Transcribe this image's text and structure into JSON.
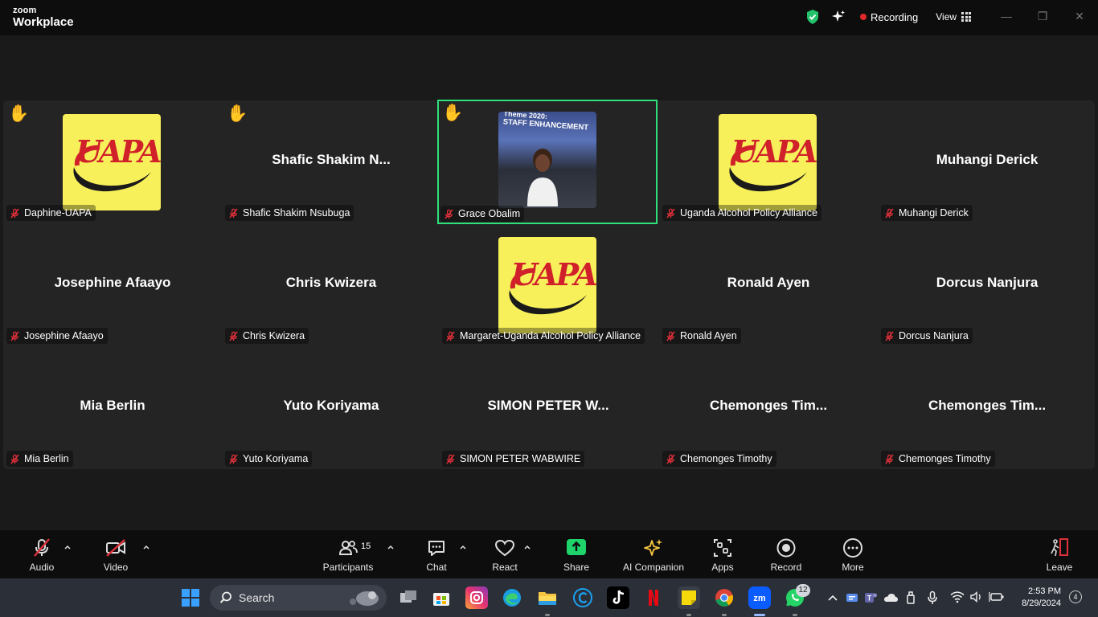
{
  "titlebar": {
    "brand_top": "zoom",
    "brand_bottom": "Workplace",
    "recording_label": "Recording",
    "view_label": "View",
    "minimize_icon": "minimize-icon",
    "maximize_icon": "maximize-icon",
    "close_icon": "close-icon"
  },
  "tiles": [
    {
      "name": "Daphine-UAPA",
      "center": "",
      "avatar": "uapa",
      "hand": true,
      "active": false
    },
    {
      "name": "Shafic Shakim Nsubuga",
      "center": "Shafic  Shakim  N...",
      "avatar": "",
      "hand": true,
      "active": false
    },
    {
      "name": "Grace Obalim",
      "center": "",
      "avatar": "photo",
      "hand": true,
      "active": true
    },
    {
      "name": "Uganda Alcohol Policy Alliance",
      "center": "",
      "avatar": "uapa",
      "hand": false,
      "active": false
    },
    {
      "name": "Muhangi Derick",
      "center": "Muhangi Derick",
      "avatar": "",
      "hand": false,
      "active": false
    },
    {
      "name": "Josephine Afaayo",
      "center": "Josephine Afaayo",
      "avatar": "",
      "hand": false,
      "active": false
    },
    {
      "name": "Chris Kwizera",
      "center": "Chris Kwizera",
      "avatar": "",
      "hand": false,
      "active": false
    },
    {
      "name": "Margaret-Uganda Alcohol Policy Alliance",
      "center": "",
      "avatar": "uapa",
      "hand": false,
      "active": false
    },
    {
      "name": "Ronald Ayen",
      "center": "Ronald Ayen",
      "avatar": "",
      "hand": false,
      "active": false
    },
    {
      "name": "Dorcus Nanjura",
      "center": "Dorcus Nanjura",
      "avatar": "",
      "hand": false,
      "active": false
    },
    {
      "name": "Mia Berlin",
      "center": "Mia Berlin",
      "avatar": "",
      "hand": false,
      "active": false
    },
    {
      "name": "Yuto Koriyama",
      "center": "Yuto Koriyama",
      "avatar": "",
      "hand": false,
      "active": false
    },
    {
      "name": "SIMON PETER WABWIRE",
      "center": "SIMON  PETER  W...",
      "avatar": "",
      "hand": false,
      "active": false
    },
    {
      "name": "Chemonges Timothy",
      "center": "Chemonges  Tim...",
      "avatar": "",
      "hand": false,
      "active": false
    },
    {
      "name": "Chemonges Timothy",
      "center": "Chemonges  Tim...",
      "avatar": "",
      "hand": false,
      "active": false
    }
  ],
  "uapa_logo_text": "UAPA",
  "grace_photo": {
    "line1": "Theme 2020:",
    "line2": "STAFF ENHANCEMENT"
  },
  "toolbar": {
    "audio": "Audio",
    "video": "Video",
    "participants": "Participants",
    "participants_count": "15",
    "chat": "Chat",
    "react": "React",
    "share": "Share",
    "ai_companion": "AI Companion",
    "apps": "Apps",
    "record": "Record",
    "more": "More",
    "leave": "Leave"
  },
  "taskbar": {
    "search_label": "Search",
    "whatsapp_badge": "12",
    "time": "2:53 PM",
    "date": "8/29/2024",
    "notifications": "4"
  },
  "colors": {
    "active_speaker": "#2ee07c",
    "recording_dot": "#e02828",
    "muted_red": "#e0303a",
    "share_green": "#1fd36b",
    "uapa_yellow": "#f7f05a"
  }
}
